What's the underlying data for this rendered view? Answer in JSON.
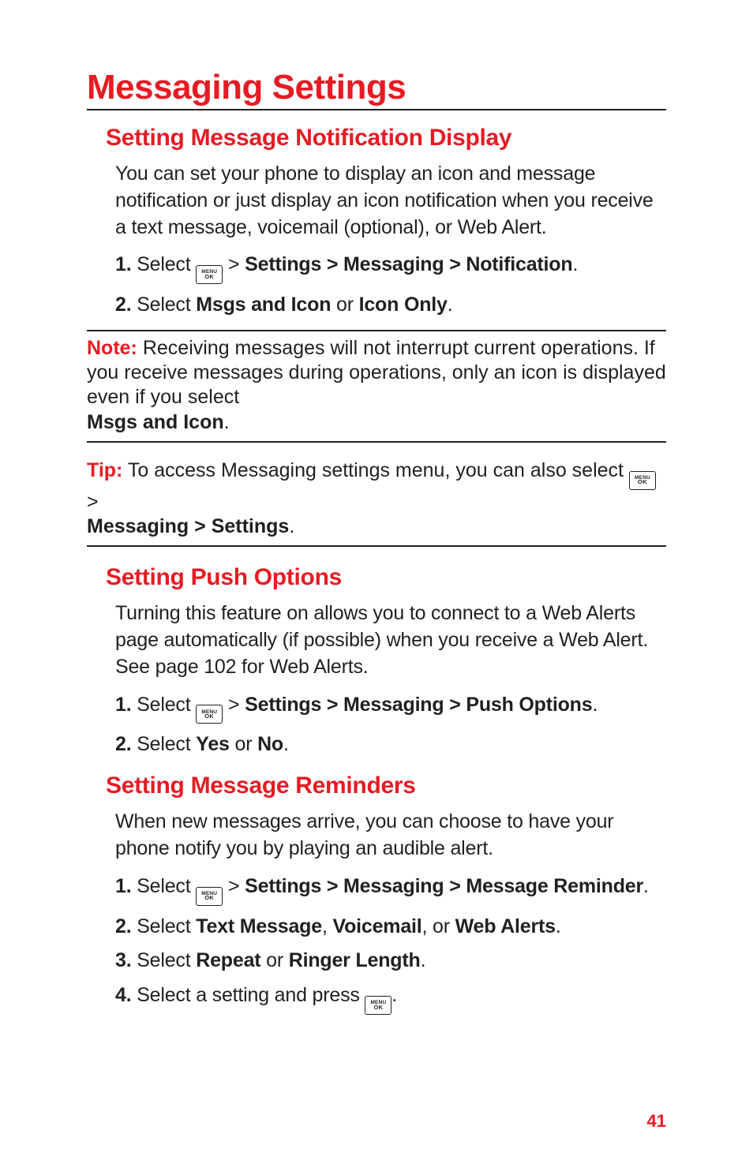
{
  "page_number": "41",
  "h1": "Messaging Settings",
  "menu_key": {
    "line1": "MENU",
    "line2": "OK"
  },
  "section1": {
    "heading": "Setting Message Notification Display",
    "intro": "You can set your phone to display an icon and message notification or just display an icon notification when you receive a text message, voicemail (optional), or Web Alert.",
    "step1_num": "1.",
    "step1_a": " Select ",
    "step1_b": " > ",
    "step1_path": "Settings > Messaging > Notification",
    "step1_end": ".",
    "step2_num": "2.",
    "step2_a": " Select ",
    "step2_opt1": "Msgs and Icon",
    "step2_mid": " or ",
    "step2_opt2": "Icon Only",
    "step2_end": "."
  },
  "note": {
    "label": "Note:",
    "text_a": " Receiving messages will not interrupt current operations. If you receive messages during operations, only an icon is displayed even if you select ",
    "bold": "Msgs and Icon",
    "text_b": "."
  },
  "tip": {
    "label": "Tip:",
    "text_a": " To access Messaging settings menu, you can also select ",
    "text_b": " > ",
    "bold": "Messaging > Settings",
    "text_c": "."
  },
  "section2": {
    "heading": "Setting Push Options",
    "intro": "Turning this feature on allows you to connect to a Web Alerts page automatically (if possible) when you receive a Web Alert. See page 102 for Web Alerts.",
    "step1_num": "1.",
    "step1_a": " Select ",
    "step1_b": " > ",
    "step1_path": "Settings > Messaging > Push Options",
    "step1_end": ".",
    "step2_num": "2.",
    "step2_a": " Select ",
    "step2_opt1": "Yes",
    "step2_mid": " or ",
    "step2_opt2": "No",
    "step2_end": "."
  },
  "section3": {
    "heading": "Setting Message Reminders",
    "intro": "When new messages arrive, you can choose to have your phone notify you by playing an audible alert.",
    "step1_num": "1.",
    "step1_a": " Select ",
    "step1_b": " > ",
    "step1_path": "Settings > Messaging > Message Reminder",
    "step1_end": ".",
    "step2_num": "2.",
    "step2_a": " Select ",
    "step2_opt1": "Text Message",
    "step2_sep1": ", ",
    "step2_opt2": "Voicemail",
    "step2_sep2": ", or ",
    "step2_opt3": "Web Alerts",
    "step2_end": ".",
    "step3_num": "3.",
    "step3_a": " Select ",
    "step3_opt1": "Repeat",
    "step3_mid": " or ",
    "step3_opt2": "Ringer Length",
    "step3_end": ".",
    "step4_num": "4.",
    "step4_a": " Select a setting and press ",
    "step4_end": "."
  }
}
